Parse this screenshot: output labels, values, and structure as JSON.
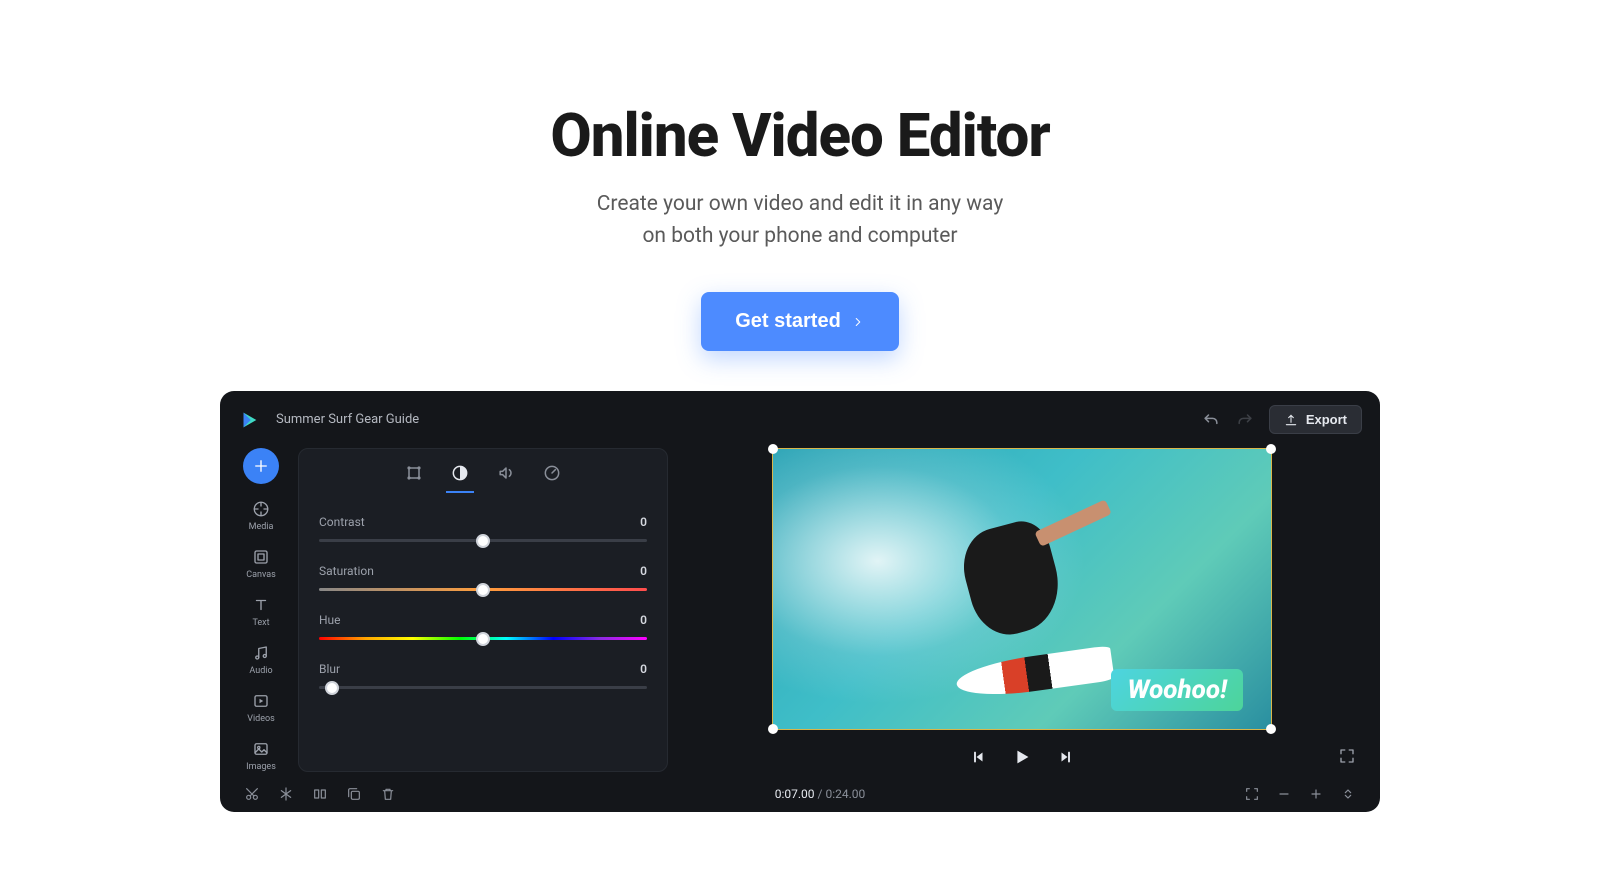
{
  "hero": {
    "title": "Online Video Editor",
    "subtitle_line1": "Create your own video and edit it in any way",
    "subtitle_line2": "on both your phone and computer",
    "cta_label": "Get started"
  },
  "editor": {
    "project_title": "Summer Surf Gear Guide",
    "export_label": "Export",
    "rail": [
      {
        "id": "media",
        "label": "Media"
      },
      {
        "id": "canvas",
        "label": "Canvas"
      },
      {
        "id": "text",
        "label": "Text"
      },
      {
        "id": "audio",
        "label": "Audio"
      },
      {
        "id": "videos",
        "label": "Videos"
      },
      {
        "id": "images",
        "label": "Images"
      }
    ],
    "adjust": {
      "sliders": [
        {
          "id": "contrast",
          "label": "Contrast",
          "value": "0",
          "pos": 50,
          "track": "plain"
        },
        {
          "id": "saturation",
          "label": "Saturation",
          "value": "0",
          "pos": 50,
          "track": "sat"
        },
        {
          "id": "hue",
          "label": "Hue",
          "value": "0",
          "pos": 50,
          "track": "hue"
        },
        {
          "id": "blur",
          "label": "Blur",
          "value": "0",
          "pos": 4,
          "track": "plain"
        }
      ]
    },
    "preview": {
      "caption": "Woohoo!"
    },
    "playback": {
      "current_time": "0:07.00",
      "total_time": "0:24.00"
    }
  }
}
